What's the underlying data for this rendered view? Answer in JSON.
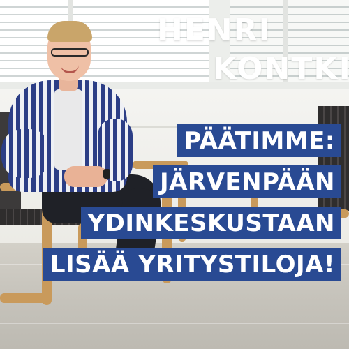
{
  "name": {
    "first": "HENRI",
    "last": "KONTKIN"
  },
  "headline": {
    "lines": [
      "PÄÄTIMME:",
      "JÄRVENPÄÄN",
      "YDINKESKUSTAAN",
      "LISÄÄ YRITYSTILOJA!"
    ]
  },
  "colors": {
    "banner_blue": "#294a93",
    "text_white": "#ffffff"
  }
}
